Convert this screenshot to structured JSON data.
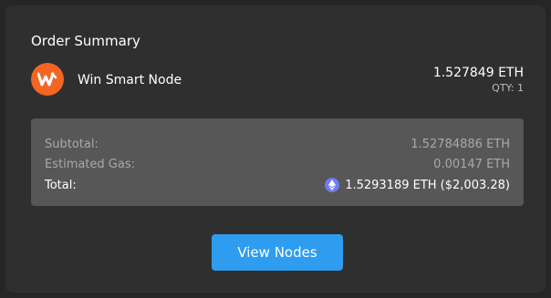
{
  "order_summary": {
    "title": "Order Summary",
    "product": {
      "logo_icon": "wwt-logo-icon",
      "name": "Win Smart Node",
      "price": "1.527849 ETH",
      "qty": "QTY: 1"
    },
    "breakdown": {
      "subtotal_label": "Subtotal:",
      "subtotal_value": "1.52784886 ETH",
      "gas_label": "Estimated Gas:",
      "gas_value": "0.00147 ETH",
      "total_label": "Total:",
      "total_icon": "ethereum-icon",
      "total_value": "1.5293189 ETH ($2,003.28)"
    },
    "button_label": "View Nodes"
  },
  "colors": {
    "card_bg": "#2f2f2f",
    "box_bg": "#575757",
    "accent": "#2e9df0",
    "logo": "#f26522",
    "eth_icon": "#6f7cf2"
  }
}
